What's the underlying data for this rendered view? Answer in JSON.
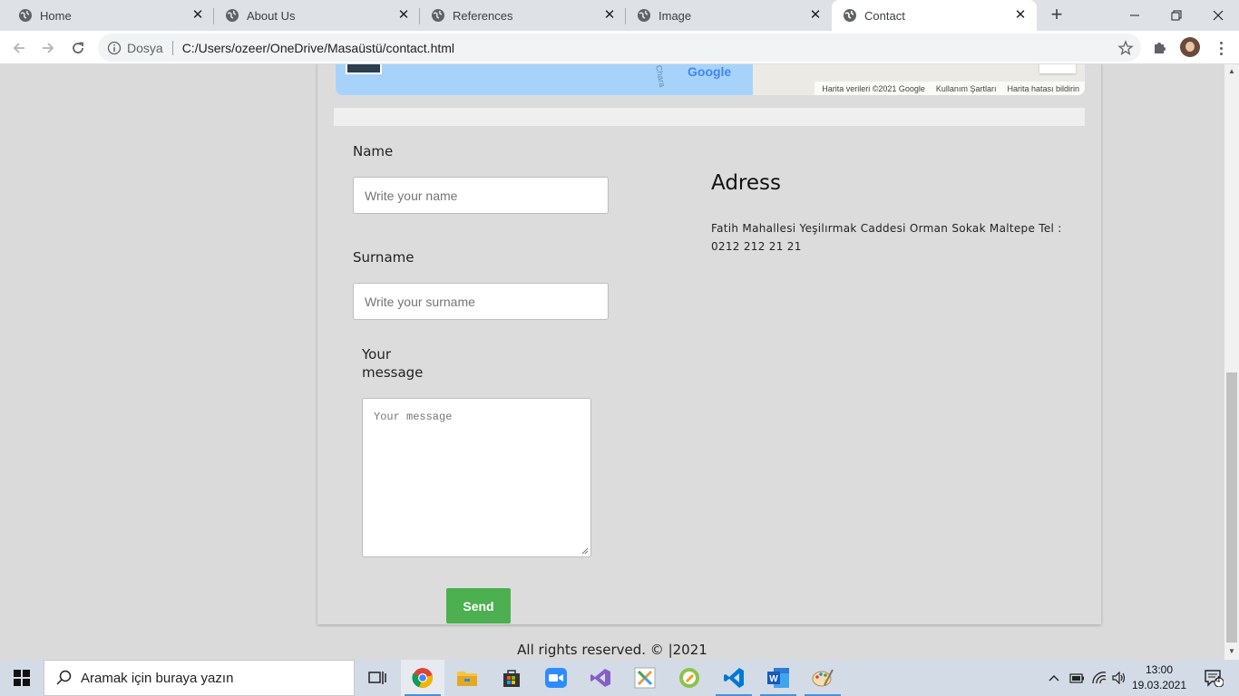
{
  "browser": {
    "tabs": [
      {
        "title": "Home",
        "active": false
      },
      {
        "title": "About Us",
        "active": false
      },
      {
        "title": "References",
        "active": false
      },
      {
        "title": "Image",
        "active": false
      },
      {
        "title": "Contact",
        "active": true
      }
    ],
    "address_bar": {
      "scheme_label": "Dosya",
      "url": "C:/Users/ozeer/OneDrive/Masaüstü/contact.html"
    }
  },
  "page": {
    "map": {
      "logo_text": "Google",
      "street_label": "Chara",
      "attribution": {
        "data": "Harita verileri ©2021 Google",
        "terms": "Kullanım Şartları",
        "report": "Harita hatası bildirin"
      }
    },
    "form": {
      "name_label": "Name",
      "name_placeholder": "Write your name",
      "surname_label": "Surname",
      "surname_placeholder": "Write your surname",
      "message_label_line1": "Your",
      "message_label_line2": "message",
      "message_placeholder": "Your message",
      "send_label": "Send",
      "send_color": "#4caf50"
    },
    "address": {
      "title": "Adress",
      "text": "Fatih Mahallesi Yeşilırmak Caddesi Orman Sokak Maltepe Tel : 0212 212 21 21"
    },
    "footer": "All rights reserved. © |2021"
  },
  "taskbar": {
    "search_placeholder": "Aramak için buraya yazın",
    "apps": [
      "task-view",
      "chrome",
      "file-explorer",
      "microsoft-store",
      "zoom",
      "visual-studio",
      "xmind",
      "notes-app",
      "vs-code",
      "word",
      "paint"
    ],
    "clock": {
      "time": "13:00",
      "date": "19.03.2021"
    },
    "notification_count": "4"
  }
}
